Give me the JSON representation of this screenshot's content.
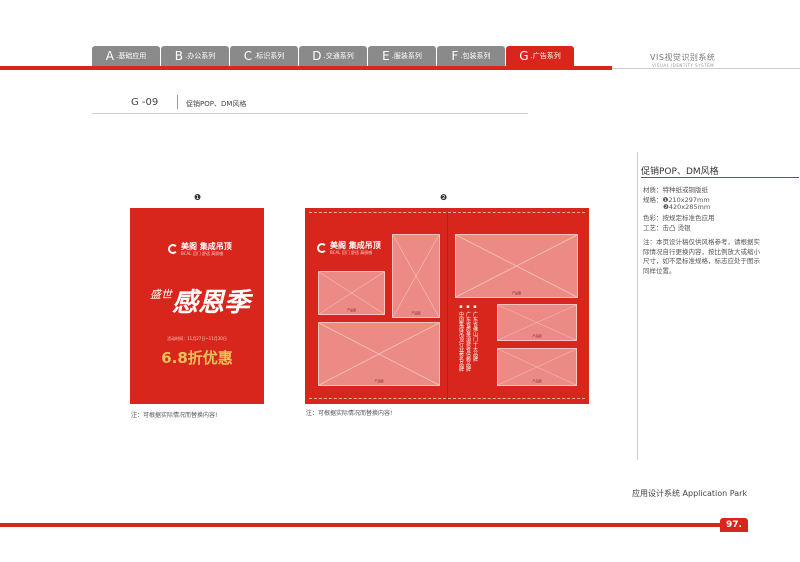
{
  "tabs": [
    {
      "letter": "A",
      "label": ".基础应用"
    },
    {
      "letter": "B",
      "label": ".办公系列"
    },
    {
      "letter": "C",
      "label": ".标识系列"
    },
    {
      "letter": "D",
      "label": ".交通系列"
    },
    {
      "letter": "E",
      "label": ".服装系列"
    },
    {
      "letter": "F",
      "label": ".包装系列"
    },
    {
      "letter": "G",
      "label": ".广告系列",
      "active": true
    }
  ],
  "header": {
    "vis_title": "VIS视觉识别系统",
    "vis_subtitle": "VISUAL IDENTITY SYSTEM"
  },
  "section": {
    "code": "G -09",
    "title": "促销POP、DM风格"
  },
  "item1": {
    "number": "❶",
    "logo_name": "美阁 集成吊顶",
    "logo_tag": "BCAL 回门 舒适 高质感",
    "slogan_small": "盛世",
    "slogan_big": "感恩季",
    "date": "活动时间：11月27日~11月30日",
    "price": "6.8折优惠",
    "note": "注：可根据实际情况而替换内容!"
  },
  "item2": {
    "number": "❷",
    "logo_name": "美阁 集成吊顶",
    "logo_tag": "BCAL 回门 舒适 高质感",
    "image_caption": "产品图",
    "bullets": [
      "▪ 广东省佛山门十大品牌",
      "▪ 广东省质量消费者信赖品牌",
      "▪ 中国集成吊顶行业著名品牌"
    ],
    "note": "注：可根据实际情况而替换内容!"
  },
  "right_panel": {
    "title": "促销POP、DM风格",
    "material": "材质：特种纸或铜版纸",
    "spec_label": "规格：",
    "spec1": "❶210x297mm",
    "spec2": "❷420x285mm",
    "color": "色彩：按规定标准色应用",
    "process": "工艺：击凸 烫银",
    "note": "注：本页设计稿仅供风格参考，请根据实际情况自行更换内容，按比例放大或缩小尺寸，如不是标准规格，标志应处于图示同样位置。"
  },
  "footer": {
    "label": "应用设计系统  Application Park",
    "page": "97."
  },
  "colors": {
    "brand_red": "#d9261c",
    "tab_gray": "#8a8a8a",
    "gold": "#e8c15a",
    "placeholder": "#ec8a86"
  }
}
